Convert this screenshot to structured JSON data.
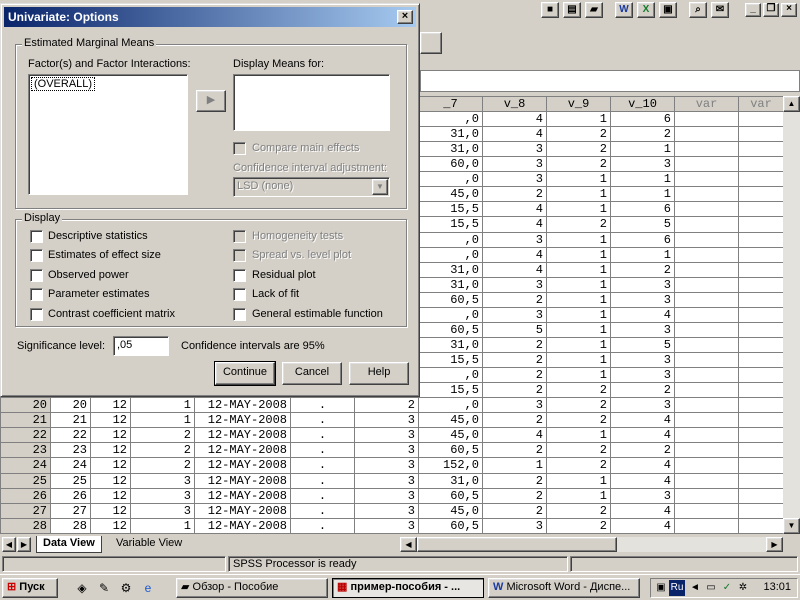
{
  "dialog": {
    "title": "Univariate: Options",
    "close_label": "×",
    "emm_group": "Estimated Marginal Means",
    "factors_label": "Factor(s) and Factor Interactions:",
    "factors_items": [
      "(OVERALL)"
    ],
    "move_button": "▶",
    "display_means_label": "Display Means for:",
    "compare_main_effects": "Compare main effects",
    "ci_adjustment_label": "Confidence interval adjustment:",
    "ci_adjustment_value": "LSD (none)",
    "display_group": "Display",
    "checkboxes_left": [
      "Descriptive statistics",
      "Estimates of effect size",
      "Observed power",
      "Parameter estimates",
      "Contrast coefficient matrix"
    ],
    "checkboxes_right": [
      "Homogeneity tests",
      "Spread vs. level plot",
      "Residual plot",
      "Lack of fit",
      "General estimable function"
    ],
    "significance_label": "Significance level:",
    "significance_value": ",05",
    "ci_text": "Confidence intervals are 95%",
    "continue_label": "Continue",
    "cancel_label": "Cancel",
    "help_label": "Help"
  },
  "grid": {
    "headers": [
      "_7",
      "v_8",
      "v_9",
      "v_10",
      "var",
      "var"
    ],
    "upper_rows": [
      [
        ",0",
        "4",
        "1",
        "6"
      ],
      [
        "31,0",
        "4",
        "2",
        "2"
      ],
      [
        "31,0",
        "3",
        "2",
        "1"
      ],
      [
        "60,0",
        "3",
        "2",
        "3"
      ],
      [
        ",0",
        "3",
        "1",
        "1"
      ],
      [
        "45,0",
        "2",
        "1",
        "1"
      ],
      [
        "15,5",
        "4",
        "1",
        "6"
      ],
      [
        "15,5",
        "4",
        "2",
        "5"
      ],
      [
        ",0",
        "3",
        "1",
        "6"
      ],
      [
        ",0",
        "4",
        "1",
        "1"
      ],
      [
        "31,0",
        "4",
        "1",
        "2"
      ],
      [
        "31,0",
        "3",
        "1",
        "3"
      ],
      [
        "60,5",
        "2",
        "1",
        "3"
      ],
      [
        ",0",
        "3",
        "1",
        "4"
      ],
      [
        "60,5",
        "5",
        "1",
        "3"
      ],
      [
        "31,0",
        "2",
        "1",
        "5"
      ],
      [
        "15,5",
        "2",
        "1",
        "3"
      ],
      [
        ",0",
        "2",
        "1",
        "3"
      ],
      [
        "15,5",
        "2",
        "2",
        "2"
      ]
    ],
    "lower_rows": [
      [
        "20",
        "20",
        "12",
        "1",
        "12-MAY-2008",
        ".",
        "2",
        ",0",
        "3",
        "2",
        "3"
      ],
      [
        "21",
        "21",
        "12",
        "1",
        "12-MAY-2008",
        ".",
        "3",
        "45,0",
        "2",
        "2",
        "4"
      ],
      [
        "22",
        "22",
        "12",
        "2",
        "12-MAY-2008",
        ".",
        "3",
        "45,0",
        "4",
        "1",
        "4"
      ],
      [
        "23",
        "23",
        "12",
        "2",
        "12-MAY-2008",
        ".",
        "3",
        "60,5",
        "2",
        "2",
        "2"
      ],
      [
        "24",
        "24",
        "12",
        "2",
        "12-MAY-2008",
        ".",
        "3",
        "152,0",
        "1",
        "2",
        "4"
      ],
      [
        "25",
        "25",
        "12",
        "3",
        "12-MAY-2008",
        ".",
        "3",
        "31,0",
        "2",
        "1",
        "4"
      ],
      [
        "26",
        "26",
        "12",
        "3",
        "12-MAY-2008",
        ".",
        "3",
        "60,5",
        "2",
        "1",
        "3"
      ],
      [
        "27",
        "27",
        "12",
        "3",
        "12-MAY-2008",
        ".",
        "3",
        "45,0",
        "2",
        "2",
        "4"
      ],
      [
        "28",
        "28",
        "12",
        "1",
        "12-MAY-2008",
        ".",
        "3",
        "60,5",
        "3",
        "2",
        "4"
      ]
    ]
  },
  "sheets": {
    "data_view": "Data View",
    "variable_view": "Variable View"
  },
  "status": {
    "processor": "SPSS Processor  is ready"
  },
  "taskbar": {
    "start_label": "Пуск",
    "tasks": [
      "Обзор - Пособие",
      "пример-пособия - ...",
      "Microsoft Word - Диспе..."
    ],
    "tray_lang": "Ru",
    "clock": "13:01"
  },
  "colors": {
    "title_start": "#0a246a",
    "title_end": "#a6caf0",
    "face": "#d4d0c8"
  }
}
